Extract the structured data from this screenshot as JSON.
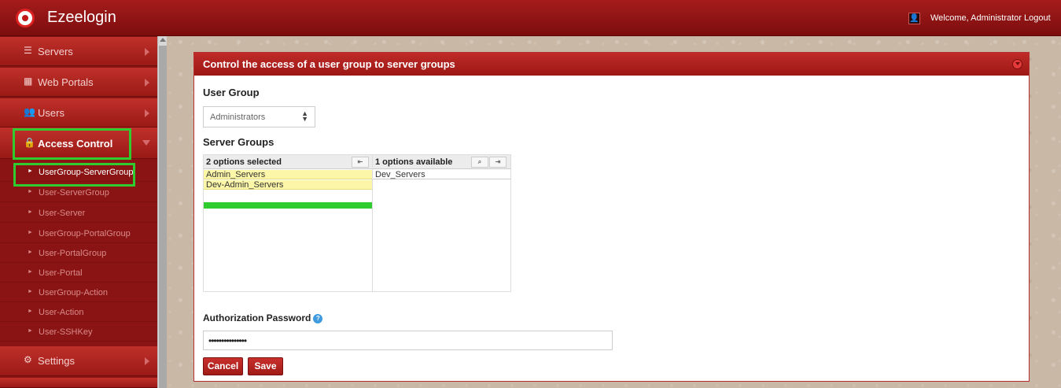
{
  "app": {
    "title": "Ezeelogin",
    "welcome": "Welcome, Administrator Logout"
  },
  "sidebar": {
    "items": [
      {
        "label": "Servers",
        "icon": "list-icon",
        "glyph": "☰"
      },
      {
        "label": "Web Portals",
        "icon": "dashboard-icon",
        "glyph": "▦"
      },
      {
        "label": "Users",
        "icon": "users-icon",
        "glyph": "👥"
      },
      {
        "label": "Access Control",
        "icon": "lock-icon",
        "glyph": "🔒",
        "active": true
      },
      {
        "label": "Settings",
        "icon": "cogs-icon",
        "glyph": "⚙"
      }
    ],
    "sub_items": [
      {
        "label": "UserGroup-ServerGroup",
        "current": true
      },
      {
        "label": "User-ServerGroup"
      },
      {
        "label": "User-Server"
      },
      {
        "label": "UserGroup-PortalGroup"
      },
      {
        "label": "User-PortalGroup"
      },
      {
        "label": "User-Portal"
      },
      {
        "label": "UserGroup-Action"
      },
      {
        "label": "User-Action"
      },
      {
        "label": "User-SSHKey"
      }
    ]
  },
  "panel": {
    "title": "Control the access of a user group to server groups",
    "user_group_label": "User Group",
    "user_group_value": "Administrators",
    "server_groups_label": "Server Groups",
    "selected_header": "2 options selected",
    "available_header": "1 options available",
    "selected_options": [
      "Admin_Servers",
      "Dev-Admin_Servers"
    ],
    "available_options": [
      "Dev_Servers"
    ],
    "auth_label": "Authorization Password",
    "auth_value": "•••••••••••••••",
    "cancel_label": "Cancel",
    "save_label": "Save"
  },
  "colors": {
    "brand_red": "#a51c1c",
    "highlight_green": "#2ecc2e",
    "selected_row": "#fbf6a8"
  }
}
